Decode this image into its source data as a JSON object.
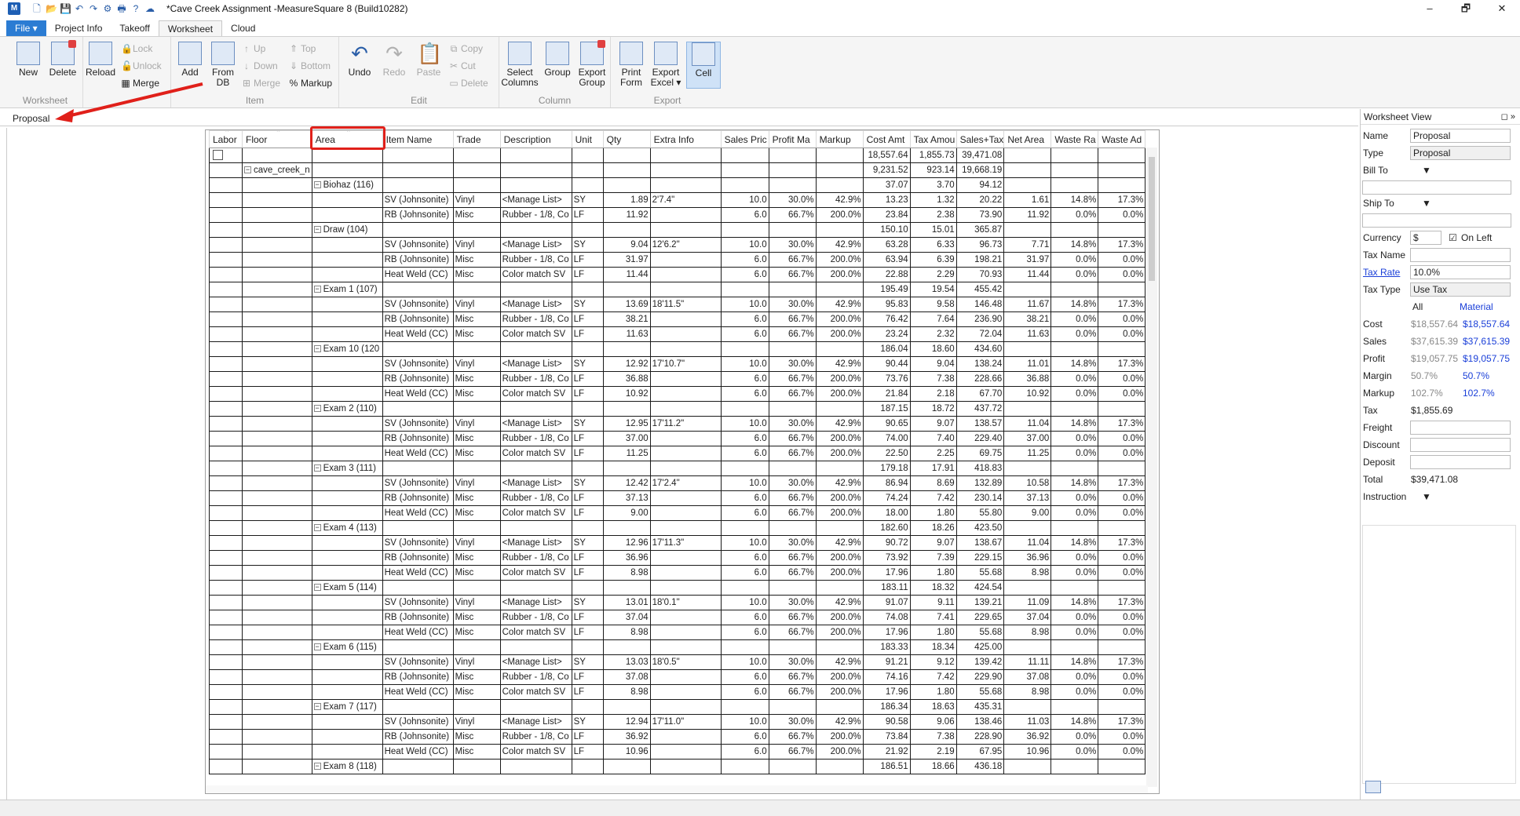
{
  "window": {
    "title": "*Cave Creek Assignment -MeasureSquare 8 (Build10282)",
    "app_icon": "M",
    "minimize": "–",
    "restore": "🗗",
    "close": "✕"
  },
  "tabs": [
    "File ▾",
    "Project Info",
    "Takeoff",
    "Worksheet",
    "Cloud"
  ],
  "ribbon": {
    "worksheet": {
      "new": "New",
      "delete": "Delete",
      "group": "Worksheet"
    },
    "reload": {
      "reload": "Reload",
      "lock": "Lock",
      "unlock": "Unlock",
      "merge": "Merge",
      "group": "Reload"
    },
    "item": {
      "add": "Add",
      "fromdb": "From DB",
      "up": "Up",
      "down": "Down",
      "merge": "Merge",
      "top": "Top",
      "bottom": "Bottom",
      "markup": "Markup",
      "group": "Item"
    },
    "edit": {
      "undo": "Undo",
      "redo": "Redo",
      "paste": "Paste",
      "copy": "Copy",
      "cut": "Cut",
      "delete": "Delete",
      "group": "Edit"
    },
    "column": {
      "select": "Select Columns",
      "group_btn": "Group",
      "export_group": "Export Group",
      "group": "Column"
    },
    "export": {
      "print": "Print Form",
      "excel": "Export Excel ▾",
      "cell": "Cell",
      "group": "Export"
    }
  },
  "breadcrumb": "Proposal",
  "columns": [
    "Labor",
    "Floor",
    "Area",
    "Item Name",
    "Trade",
    "Description",
    "Unit",
    "Qty",
    "Extra Info",
    "Sales Pric",
    "Profit Ma",
    "Markup",
    "Cost Amt",
    "Tax Amou",
    "Sales+Tax",
    "Net Area",
    "Waste Ra",
    "Waste Ad"
  ],
  "grand_total": {
    "cost": "18,557.64",
    "tax": "1,855.73",
    "sales": "39,471.08"
  },
  "floor": {
    "name": "cave_creek_n",
    "cost": "9,231.52",
    "tax": "923.14",
    "sales": "19,668.19"
  },
  "groups": [
    {
      "area": "Biohaz (116)",
      "cost": "37.07",
      "tax": "3.70",
      "sales": "94.12",
      "rows": [
        [
          "SV (Johnsonite)",
          "Vinyl",
          "<Manage List>",
          "SY",
          "1.89",
          "2'7.4\"",
          "10.0",
          "30.0%",
          "42.9%",
          "13.23",
          "1.32",
          "20.22",
          "1.61",
          "14.8%",
          "17.3%"
        ],
        [
          "RB (Johnsonite)",
          "Misc",
          "Rubber - 1/8, Co",
          "LF",
          "11.92",
          "",
          "6.0",
          "66.7%",
          "200.0%",
          "23.84",
          "2.38",
          "73.90",
          "11.92",
          "0.0%",
          "0.0%"
        ]
      ]
    },
    {
      "area": "Draw (104)",
      "cost": "150.10",
      "tax": "15.01",
      "sales": "365.87",
      "rows": [
        [
          "SV (Johnsonite)",
          "Vinyl",
          "<Manage List>",
          "SY",
          "9.04",
          "12'6.2\"",
          "10.0",
          "30.0%",
          "42.9%",
          "63.28",
          "6.33",
          "96.73",
          "7.71",
          "14.8%",
          "17.3%"
        ],
        [
          "RB (Johnsonite)",
          "Misc",
          "Rubber - 1/8, Co",
          "LF",
          "31.97",
          "",
          "6.0",
          "66.7%",
          "200.0%",
          "63.94",
          "6.39",
          "198.21",
          "31.97",
          "0.0%",
          "0.0%"
        ],
        [
          "Heat Weld (CC)",
          "Misc",
          "Color match SV",
          "LF",
          "11.44",
          "",
          "6.0",
          "66.7%",
          "200.0%",
          "22.88",
          "2.29",
          "70.93",
          "11.44",
          "0.0%",
          "0.0%"
        ]
      ]
    },
    {
      "area": "Exam 1 (107)",
      "cost": "195.49",
      "tax": "19.54",
      "sales": "455.42",
      "rows": [
        [
          "SV (Johnsonite)",
          "Vinyl",
          "<Manage List>",
          "SY",
          "13.69",
          "18'11.5\"",
          "10.0",
          "30.0%",
          "42.9%",
          "95.83",
          "9.58",
          "146.48",
          "11.67",
          "14.8%",
          "17.3%"
        ],
        [
          "RB (Johnsonite)",
          "Misc",
          "Rubber - 1/8, Co",
          "LF",
          "38.21",
          "",
          "6.0",
          "66.7%",
          "200.0%",
          "76.42",
          "7.64",
          "236.90",
          "38.21",
          "0.0%",
          "0.0%"
        ],
        [
          "Heat Weld (CC)",
          "Misc",
          "Color match SV",
          "LF",
          "11.63",
          "",
          "6.0",
          "66.7%",
          "200.0%",
          "23.24",
          "2.32",
          "72.04",
          "11.63",
          "0.0%",
          "0.0%"
        ]
      ]
    },
    {
      "area": "Exam 10 (120",
      "cost": "186.04",
      "tax": "18.60",
      "sales": "434.60",
      "rows": [
        [
          "SV (Johnsonite)",
          "Vinyl",
          "<Manage List>",
          "SY",
          "12.92",
          "17'10.7\"",
          "10.0",
          "30.0%",
          "42.9%",
          "90.44",
          "9.04",
          "138.24",
          "11.01",
          "14.8%",
          "17.3%"
        ],
        [
          "RB (Johnsonite)",
          "Misc",
          "Rubber - 1/8, Co",
          "LF",
          "36.88",
          "",
          "6.0",
          "66.7%",
          "200.0%",
          "73.76",
          "7.38",
          "228.66",
          "36.88",
          "0.0%",
          "0.0%"
        ],
        [
          "Heat Weld (CC)",
          "Misc",
          "Color match SV",
          "LF",
          "10.92",
          "",
          "6.0",
          "66.7%",
          "200.0%",
          "21.84",
          "2.18",
          "67.70",
          "10.92",
          "0.0%",
          "0.0%"
        ]
      ]
    },
    {
      "area": "Exam 2 (110)",
      "cost": "187.15",
      "tax": "18.72",
      "sales": "437.72",
      "rows": [
        [
          "SV (Johnsonite)",
          "Vinyl",
          "<Manage List>",
          "SY",
          "12.95",
          "17'11.2\"",
          "10.0",
          "30.0%",
          "42.9%",
          "90.65",
          "9.07",
          "138.57",
          "11.04",
          "14.8%",
          "17.3%"
        ],
        [
          "RB (Johnsonite)",
          "Misc",
          "Rubber - 1/8, Co",
          "LF",
          "37.00",
          "",
          "6.0",
          "66.7%",
          "200.0%",
          "74.00",
          "7.40",
          "229.40",
          "37.00",
          "0.0%",
          "0.0%"
        ],
        [
          "Heat Weld (CC)",
          "Misc",
          "Color match SV",
          "LF",
          "11.25",
          "",
          "6.0",
          "66.7%",
          "200.0%",
          "22.50",
          "2.25",
          "69.75",
          "11.25",
          "0.0%",
          "0.0%"
        ]
      ]
    },
    {
      "area": "Exam 3 (111)",
      "cost": "179.18",
      "tax": "17.91",
      "sales": "418.83",
      "rows": [
        [
          "SV (Johnsonite)",
          "Vinyl",
          "<Manage List>",
          "SY",
          "12.42",
          "17'2.4\"",
          "10.0",
          "30.0%",
          "42.9%",
          "86.94",
          "8.69",
          "132.89",
          "10.58",
          "14.8%",
          "17.3%"
        ],
        [
          "RB (Johnsonite)",
          "Misc",
          "Rubber - 1/8, Co",
          "LF",
          "37.13",
          "",
          "6.0",
          "66.7%",
          "200.0%",
          "74.24",
          "7.42",
          "230.14",
          "37.13",
          "0.0%",
          "0.0%"
        ],
        [
          "Heat Weld (CC)",
          "Misc",
          "Color match SV",
          "LF",
          "9.00",
          "",
          "6.0",
          "66.7%",
          "200.0%",
          "18.00",
          "1.80",
          "55.80",
          "9.00",
          "0.0%",
          "0.0%"
        ]
      ]
    },
    {
      "area": "Exam 4 (113)",
      "cost": "182.60",
      "tax": "18.26",
      "sales": "423.50",
      "rows": [
        [
          "SV (Johnsonite)",
          "Vinyl",
          "<Manage List>",
          "SY",
          "12.96",
          "17'11.3\"",
          "10.0",
          "30.0%",
          "42.9%",
          "90.72",
          "9.07",
          "138.67",
          "11.04",
          "14.8%",
          "17.3%"
        ],
        [
          "RB (Johnsonite)",
          "Misc",
          "Rubber - 1/8, Co",
          "LF",
          "36.96",
          "",
          "6.0",
          "66.7%",
          "200.0%",
          "73.92",
          "7.39",
          "229.15",
          "36.96",
          "0.0%",
          "0.0%"
        ],
        [
          "Heat Weld (CC)",
          "Misc",
          "Color match SV",
          "LF",
          "8.98",
          "",
          "6.0",
          "66.7%",
          "200.0%",
          "17.96",
          "1.80",
          "55.68",
          "8.98",
          "0.0%",
          "0.0%"
        ]
      ]
    },
    {
      "area": "Exam 5 (114)",
      "cost": "183.11",
      "tax": "18.32",
      "sales": "424.54",
      "rows": [
        [
          "SV (Johnsonite)",
          "Vinyl",
          "<Manage List>",
          "SY",
          "13.01",
          "18'0.1\"",
          "10.0",
          "30.0%",
          "42.9%",
          "91.07",
          "9.11",
          "139.21",
          "11.09",
          "14.8%",
          "17.3%"
        ],
        [
          "RB (Johnsonite)",
          "Misc",
          "Rubber - 1/8, Co",
          "LF",
          "37.04",
          "",
          "6.0",
          "66.7%",
          "200.0%",
          "74.08",
          "7.41",
          "229.65",
          "37.04",
          "0.0%",
          "0.0%"
        ],
        [
          "Heat Weld (CC)",
          "Misc",
          "Color match SV",
          "LF",
          "8.98",
          "",
          "6.0",
          "66.7%",
          "200.0%",
          "17.96",
          "1.80",
          "55.68",
          "8.98",
          "0.0%",
          "0.0%"
        ]
      ]
    },
    {
      "area": "Exam 6 (115)",
      "cost": "183.33",
      "tax": "18.34",
      "sales": "425.00",
      "rows": [
        [
          "SV (Johnsonite)",
          "Vinyl",
          "<Manage List>",
          "SY",
          "13.03",
          "18'0.5\"",
          "10.0",
          "30.0%",
          "42.9%",
          "91.21",
          "9.12",
          "139.42",
          "11.11",
          "14.8%",
          "17.3%"
        ],
        [
          "RB (Johnsonite)",
          "Misc",
          "Rubber - 1/8, Co",
          "LF",
          "37.08",
          "",
          "6.0",
          "66.7%",
          "200.0%",
          "74.16",
          "7.42",
          "229.90",
          "37.08",
          "0.0%",
          "0.0%"
        ],
        [
          "Heat Weld (CC)",
          "Misc",
          "Color match SV",
          "LF",
          "8.98",
          "",
          "6.0",
          "66.7%",
          "200.0%",
          "17.96",
          "1.80",
          "55.68",
          "8.98",
          "0.0%",
          "0.0%"
        ]
      ]
    },
    {
      "area": "Exam 7 (117)",
      "cost": "186.34",
      "tax": "18.63",
      "sales": "435.31",
      "rows": [
        [
          "SV (Johnsonite)",
          "Vinyl",
          "<Manage List>",
          "SY",
          "12.94",
          "17'11.0\"",
          "10.0",
          "30.0%",
          "42.9%",
          "90.58",
          "9.06",
          "138.46",
          "11.03",
          "14.8%",
          "17.3%"
        ],
        [
          "RB (Johnsonite)",
          "Misc",
          "Rubber - 1/8, Co",
          "LF",
          "36.92",
          "",
          "6.0",
          "66.7%",
          "200.0%",
          "73.84",
          "7.38",
          "228.90",
          "36.92",
          "0.0%",
          "0.0%"
        ],
        [
          "Heat Weld (CC)",
          "Misc",
          "Color match SV",
          "LF",
          "10.96",
          "",
          "6.0",
          "66.7%",
          "200.0%",
          "21.92",
          "2.19",
          "67.95",
          "10.96",
          "0.0%",
          "0.0%"
        ]
      ]
    },
    {
      "area": "Exam 8 (118)",
      "cost": "186.51",
      "tax": "18.66",
      "sales": "436.18",
      "rows": []
    }
  ],
  "panel": {
    "title": "Worksheet View",
    "pin": "◻",
    "close": "»",
    "name_label": "Name",
    "name": "Proposal",
    "type_label": "Type",
    "type": "Proposal",
    "billto_label": "Bill To",
    "shipto_label": "Ship To",
    "currency_label": "Currency",
    "currency": "$",
    "onleft": "On Left",
    "taxname_label": "Tax Name",
    "taxrate_label": "Tax Rate",
    "taxrate": "10.0%",
    "taxtype_label": "Tax Type",
    "taxtype": "Use Tax",
    "all": "All",
    "material": "Material",
    "cost_label": "Cost",
    "cost_all": "$18,557.64",
    "cost_mat": "$18,557.64",
    "sales_label": "Sales",
    "sales_all": "$37,615.39",
    "sales_mat": "$37,615.39",
    "profit_label": "Profit",
    "profit_all": "$19,057.75",
    "profit_mat": "$19,057.75",
    "margin_label": "Margin",
    "margin_all": "50.7%",
    "margin_mat": "50.7%",
    "markup_label": "Markup",
    "markup_all": "102.7%",
    "markup_mat": "102.7%",
    "tax_label": "Tax",
    "tax": "$1,855.69",
    "freight_label": "Freight",
    "discount_label": "Discount",
    "deposit_label": "Deposit",
    "total_label": "Total",
    "total": "$39,471.08",
    "instruction_label": "Instruction"
  },
  "colors": {
    "accent": "#2b7cd3",
    "highlight": "#e0201a",
    "link": "#1a3fd8"
  }
}
